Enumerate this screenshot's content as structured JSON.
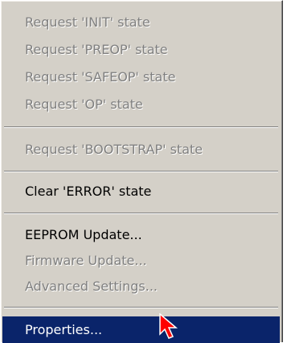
{
  "menu": {
    "items": [
      {
        "label": "Request 'INIT' state",
        "enabled": false
      },
      {
        "label": "Request 'PREOP' state",
        "enabled": false
      },
      {
        "label": "Request 'SAFEOP' state",
        "enabled": false
      },
      {
        "label": "Request 'OP' state",
        "enabled": false
      },
      {
        "label": "Request 'BOOTSTRAP' state",
        "enabled": false
      },
      {
        "label": "Clear 'ERROR' state",
        "enabled": true
      },
      {
        "label": "EEPROM Update...",
        "enabled": true
      },
      {
        "label": "Firmware Update...",
        "enabled": false
      },
      {
        "label": "Advanced Settings...",
        "enabled": false
      },
      {
        "label": "Properties...",
        "enabled": true,
        "selected": true
      }
    ]
  },
  "colors": {
    "menu_bg": "#d4d0c8",
    "highlight": "#0a246a",
    "disabled_text": "#808080",
    "cursor": "#ff0000"
  },
  "icons": {
    "cursor": "mouse-pointer-arrow-icon"
  }
}
